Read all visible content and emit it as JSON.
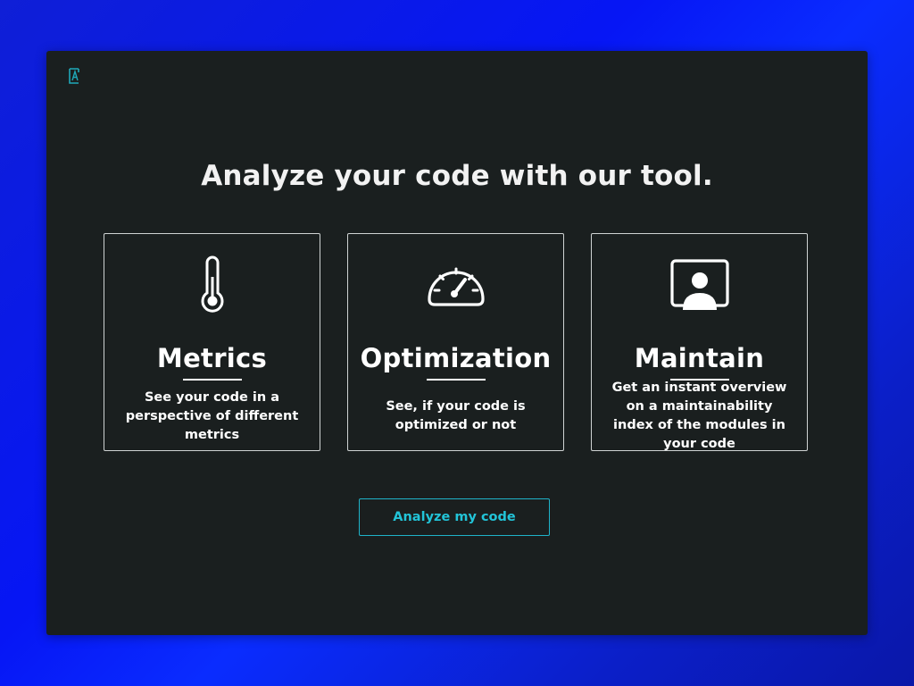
{
  "app": {
    "logo_icon": "brand-logo-icon",
    "accent_color": "#22c4d8"
  },
  "hero": {
    "headline": "Analyze your code with our tool."
  },
  "features": [
    {
      "icon": "thermometer-icon",
      "title": "Metrics",
      "description": "See your code in a perspective of different metrics"
    },
    {
      "icon": "speedometer-icon",
      "title": "Optimization",
      "description": "See, if your code is optimized or not"
    },
    {
      "icon": "user-monitor-icon",
      "title": "Maintain",
      "description": "Get an instant overview on a maintainability index of the modules in your code"
    }
  ],
  "cta": {
    "label": "Analyze my code"
  }
}
